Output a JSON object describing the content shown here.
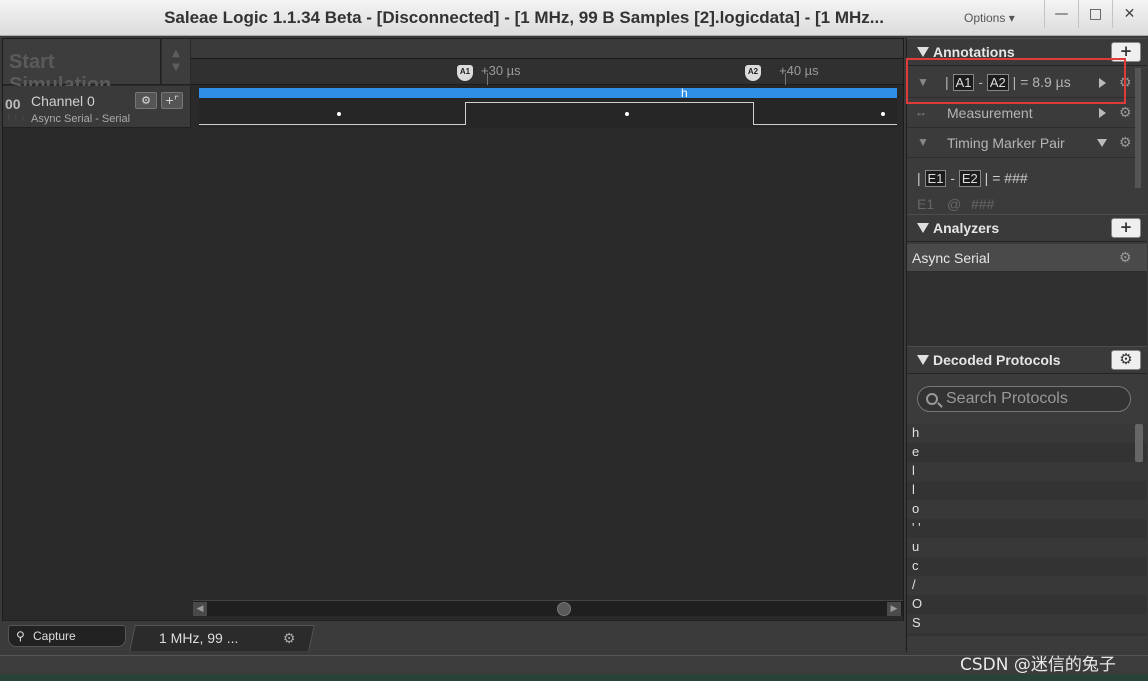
{
  "window": {
    "title": "Saleae Logic 1.1.34 Beta - [Disconnected] - [1 MHz, 99 B Samples [2].logicdata] - [1 MHz...",
    "options_label": "Options ▾"
  },
  "toolbar": {
    "start_simulation": "Start Simulation"
  },
  "timeline": {
    "label_30": "+30 µs",
    "label_40": "+40 µs",
    "marker_a1": "A1",
    "marker_a2": "A2"
  },
  "channel": {
    "number": "00",
    "name": "Channel 0",
    "subtitle": "Async Serial - Serial",
    "bus_label": "h"
  },
  "bottom_tabs": {
    "capture": "Capture",
    "file": "1 MHz, 99 ..."
  },
  "annotations": {
    "title": "Annotations",
    "pair_a1": "A1",
    "pair_a2": "A2",
    "pair_value": "= 8.9 µs",
    "measurement": "Measurement",
    "timing_marker_pair": "Timing Marker Pair",
    "pair_e1": "E1",
    "pair_e2": "E2",
    "pair_e_value": "= ###",
    "e1_label": "E1",
    "e1_at": "@",
    "e1_value": "###"
  },
  "analyzers": {
    "title": "Analyzers",
    "item": "Async Serial"
  },
  "decoded": {
    "title": "Decoded Protocols",
    "search_placeholder": "Search Protocols",
    "items": [
      "h",
      "e",
      "l",
      "l",
      "o",
      "' '",
      "u",
      "c",
      "/",
      "O",
      "S",
      "\\n"
    ]
  },
  "watermark": "CSDN @迷信的兔子"
}
